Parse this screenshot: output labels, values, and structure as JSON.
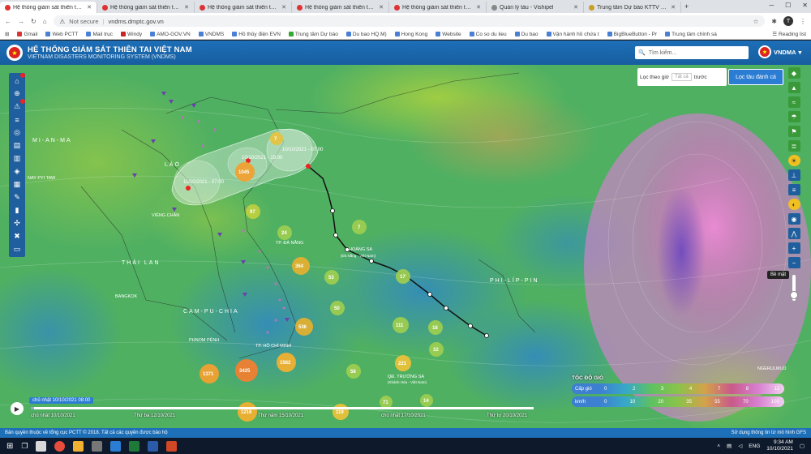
{
  "browser": {
    "tabs": [
      {
        "label": "Hệ thống giám sát thiên tai Việt",
        "active": true
      },
      {
        "label": "Hệ thống giám sát thiên tai Việt",
        "active": false
      },
      {
        "label": "Hệ thống giám sát thiên tai Việt",
        "active": false
      },
      {
        "label": "Hệ thống giám sát thiên tai Việt",
        "active": false
      },
      {
        "label": "Hệ thống giám sát thiên tai Việt",
        "active": false
      },
      {
        "label": "Quản lý tàu - Vishipel",
        "active": false
      },
      {
        "label": "Trung tâm Dự báo KTTV quốc g",
        "active": false
      }
    ],
    "security": "Not secure",
    "url": "vndms.dmptc.gov.vn",
    "profile_initial": "T",
    "bookmarks": [
      "Gmail",
      "Web PCTT",
      "Mail trục",
      "Windy",
      "AMO-GOV.VN",
      "VNDMS",
      "Hồ thủy điện EVN",
      "Trung tâm Dự báo",
      "Du bao HQ.M)",
      "Hong Kong",
      "Website",
      "Co so du lieu",
      "Du bao",
      "Vận hành hồ chứa t",
      "BigBlueButton - Pr",
      "Trung tâm chính sá"
    ],
    "reading_list": "Reading list"
  },
  "header": {
    "title": "HỆ THỐNG GIÁM SÁT THIÊN TAI VIỆT NAM",
    "subtitle": "VIETNAM DISASTERS MONITORING SYSTEM (VNDMS)",
    "search_placeholder": "Tìm kiếm...",
    "user": "VNDMA"
  },
  "filter": {
    "label": "Lọc theo giờ",
    "select_value": "Tất cả",
    "suffix": "trước",
    "button": "Lọc tàu đánh cá"
  },
  "map": {
    "countries": [
      "MI-AN-MA",
      "LÀO",
      "THÁI LAN",
      "CAM-PU-CHIA",
      "PHI-LÍP-PIN"
    ],
    "places": [
      "NAY PYI TAW",
      "VIÊNG CHĂN",
      "BANGKOK",
      "PHNOM PÊNH",
      "TP. ĐÀ NẴNG",
      "HOÀNG SA",
      "QĐ. TRƯỜNG SA",
      "TP. HỒ CHÍ MINH",
      "NGERULMUD"
    ],
    "hoang_sa_sub": "(Đà Nẵng - Việt Nam)",
    "truong_sa_sub": "(Khánh Hòa - Việt Nam)",
    "storm_labels": [
      "10/10/2021 - 07:00",
      "11/10/2021 - 07:00",
      "10/10/2021 - 19:00"
    ],
    "clusters": [
      "7",
      "1045",
      "97",
      "24",
      "7",
      "364",
      "53",
      "17",
      "50",
      "536",
      "111",
      "18",
      "32",
      "1582",
      "221",
      "58",
      "1371",
      "3425",
      "1216",
      "119",
      "71",
      "14"
    ],
    "surface_label": "Bề mặt"
  },
  "wind_legend": {
    "title": "TỐC ĐỘ GIÓ",
    "row1_label": "Cấp gió",
    "row1_values": [
      "0",
      "2",
      "3",
      "4",
      "7",
      "8",
      "11"
    ],
    "row2_label": "km/h",
    "row2_values": [
      "0",
      "10",
      "20",
      "35",
      "55",
      "70",
      "100"
    ]
  },
  "timeline": {
    "current": "chủ nhật 10/10/2021 08:00",
    "labels": [
      "chủ nhật 10/10/2021",
      "Thứ ba 12/10/2021",
      "Thứ năm 15/10/2021",
      "chủ nhật 17/10/2021",
      "Thứ tư 20/10/2021"
    ]
  },
  "status": {
    "left": "Bản quyền thuộc về tổng cục PCTT © 2018. Tất cả các quyền được bảo hộ",
    "right": "Sử dụng thông tin từ mô hình GFS"
  },
  "taskbar": {
    "lang": "ENG",
    "time": "9:34 AM",
    "date": "10/10/2021"
  },
  "colors": {
    "brand": "#1d6fb8",
    "accent": "#2b7cd3",
    "cluster": "#f0b030"
  }
}
